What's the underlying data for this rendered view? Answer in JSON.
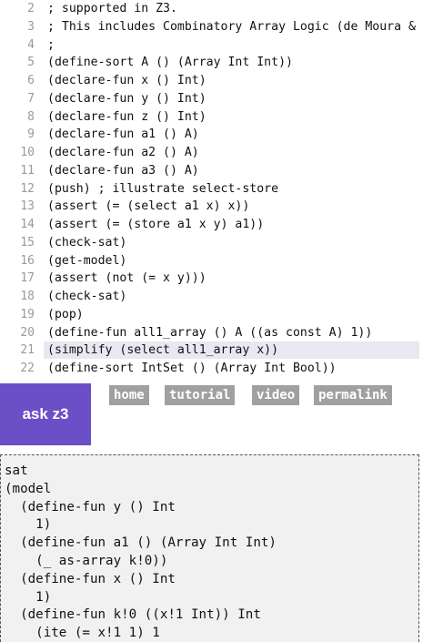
{
  "editor": {
    "lines": [
      {
        "num": "2",
        "text": "; supported in Z3."
      },
      {
        "num": "3",
        "text": "; This includes Combinatory Array Logic (de Moura &"
      },
      {
        "num": "4",
        "text": ";"
      },
      {
        "num": "5",
        "text": "(define-sort A () (Array Int Int))"
      },
      {
        "num": "6",
        "text": "(declare-fun x () Int)"
      },
      {
        "num": "7",
        "text": "(declare-fun y () Int)"
      },
      {
        "num": "8",
        "text": "(declare-fun z () Int)"
      },
      {
        "num": "9",
        "text": "(declare-fun a1 () A)"
      },
      {
        "num": "10",
        "text": "(declare-fun a2 () A)"
      },
      {
        "num": "11",
        "text": "(declare-fun a3 () A)"
      },
      {
        "num": "12",
        "text": "(push) ; illustrate select-store"
      },
      {
        "num": "13",
        "text": "(assert (= (select a1 x) x))"
      },
      {
        "num": "14",
        "text": "(assert (= (store a1 x y) a1))"
      },
      {
        "num": "15",
        "text": "(check-sat)"
      },
      {
        "num": "16",
        "text": "(get-model)"
      },
      {
        "num": "17",
        "text": "(assert (not (= x y)))"
      },
      {
        "num": "18",
        "text": "(check-sat)"
      },
      {
        "num": "19",
        "text": "(pop)"
      },
      {
        "num": "20",
        "text": "(define-fun all1_array () A ((as const A) 1))"
      },
      {
        "num": "21",
        "text": "(simplify (select all1_array x))"
      },
      {
        "num": "22",
        "text": "(define-sort IntSet () (Array Int Bool))"
      }
    ],
    "active_line": "21"
  },
  "toolbar": {
    "ask_label": "ask z3",
    "home_label": "home",
    "tutorial_label": "tutorial",
    "video_label": "video",
    "permalink_label": "permalink"
  },
  "output": {
    "text": "sat\n(model\n  (define-fun y () Int\n    1)\n  (define-fun a1 () (Array Int Int)\n    (_ as-array k!0))\n  (define-fun x () Int\n    1)\n  (define-fun k!0 ((x!1 Int)) Int\n    (ite (= x!1 1) 1"
  },
  "colors": {
    "ask_button_bg": "#6a4fc7",
    "nav_button_bg": "#a0a0a0",
    "output_bg": "#f1f1f1",
    "active_line_bg": "#e8e8f2"
  }
}
